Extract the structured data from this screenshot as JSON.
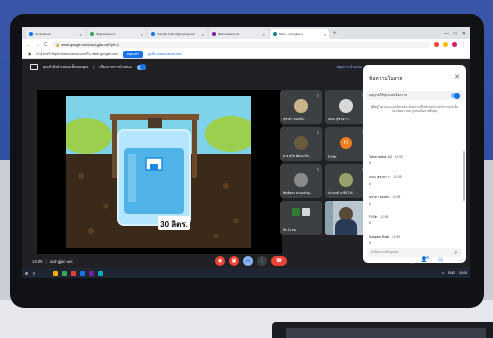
{
  "browser": {
    "tabs": [
      {
        "label": "Vii Students",
        "favicon_color": "#1a73e8",
        "active": false
      },
      {
        "label": "Ilkgoocrasoom",
        "favicon_color": "#34a853",
        "active": false
      },
      {
        "label": "Tutorial 3 Ilkv Ilkgoocrasoom",
        "favicon_color": "#1a73e8",
        "active": false
      },
      {
        "label": "Ilkstuvwaterc ss",
        "favicon_color": "#7b1fa2",
        "active": false
      },
      {
        "label": "Meet - ucd-gjiac-u",
        "favicon_color": "#00897b",
        "active": true
      }
    ],
    "new_tab": "+",
    "window_controls": [
      "—",
      "□",
      "✕"
    ],
    "url": "meet.google.com/ucd-gjac-uei?pli=1",
    "nav_icons": {
      "back": "←",
      "forward": "→",
      "reload": "C"
    }
  },
  "notice_bar": {
    "text": "กำลังแชร์ https://www.canva.com/ใน meet.google.com",
    "button": "หยุดแชร์",
    "link": "ดูแท็บ www.canva.com"
  },
  "meet_top": {
    "presenting_text": "คุณกำลังนำเสนอแท็บของคุณ",
    "audio_text": "เสียงจากการนำเสนอ",
    "stop_link": "หยุดการนำเสนอ"
  },
  "slide": {
    "bucket_label": "30 ลิตร.",
    "sky_color": "#7fd3e8",
    "ground_color": "#3b2a1a"
  },
  "tiles": [
    {
      "name": "สุชาดา ทองทับ...",
      "type": "avatar",
      "avatar_color": "#c9b48a"
    },
    {
      "name": "นนท. สุชาดา ร.",
      "type": "avatar",
      "avatar_color": "#d8d8d8"
    },
    {
      "name": "ด.ช สุวิช พัฒนะกิจ...",
      "type": "avatar",
      "avatar_color": "#6a5a40"
    },
    {
      "name": "Fi Rin",
      "type": "letter",
      "letter": "Fi"
    },
    {
      "name": "พิมพ์ลดา ครองอรัญ...",
      "type": "avatar",
      "avatar_color": "#8a8a8a"
    },
    {
      "name": "ประยงค์ อารีย์ 1/4",
      "type": "avatar",
      "avatar_color": "#9aa06a"
    },
    {
      "name": "อีก 11 คน",
      "type": "group",
      "avatar_color": "#2e7d32"
    },
    {
      "name": "คุณ",
      "type": "self",
      "avatar_color": "#7a8a98"
    }
  ],
  "chat": {
    "title": "ข้อความในสาย",
    "toggle_label": "อนุญาตให้ทุกคนส่งข้อความ",
    "notice": "ผู้ที่อยู่ในสายจะมองเห็นเฉพาะข้อความที่ได้รับหลังจากเข้าร่วมเท่านั้น และข้อความจะถูกลบเมื่อสายสิ้นสุด",
    "messages": [
      {
        "sender": "Tahar rasins 1/4",
        "time": "12:58",
        "body": "6"
      },
      {
        "sender": "นนท. สุชาดา ร.",
        "time": "12:58",
        "body": "6"
      },
      {
        "sender": "สุชาดา ทองทับ",
        "time": "12:58",
        "body": "6"
      },
      {
        "sender": "Fi Rin",
        "time": "12:58",
        "body": "6"
      },
      {
        "sender": "Kanyara Roial",
        "time": "12:59",
        "body": "6"
      }
    ],
    "input_placeholder": "ส่งข้อความถึงทุกคน",
    "close": "✕",
    "send": "➤"
  },
  "bottom_bar": {
    "time": "13:00",
    "meeting_code": "ucd-gjac-uei",
    "separator": "|",
    "participant_count": "16"
  },
  "controls": [
    {
      "name": "mic-button",
      "glyph": "🎙",
      "color": "#ea4335"
    },
    {
      "name": "camera-button",
      "glyph": "▣",
      "color": "#ea4335"
    },
    {
      "name": "present-button",
      "glyph": "▭",
      "color": "#8ab4f8"
    },
    {
      "name": "more-button",
      "glyph": "⋮",
      "color": "#3c4043"
    },
    {
      "name": "leave-button",
      "glyph": "☎",
      "color": "#ea4335"
    }
  ],
  "taskbar": {
    "start": "⊞",
    "search": "⚲",
    "tray": [
      "∧",
      "ENG",
      "13:00"
    ]
  }
}
